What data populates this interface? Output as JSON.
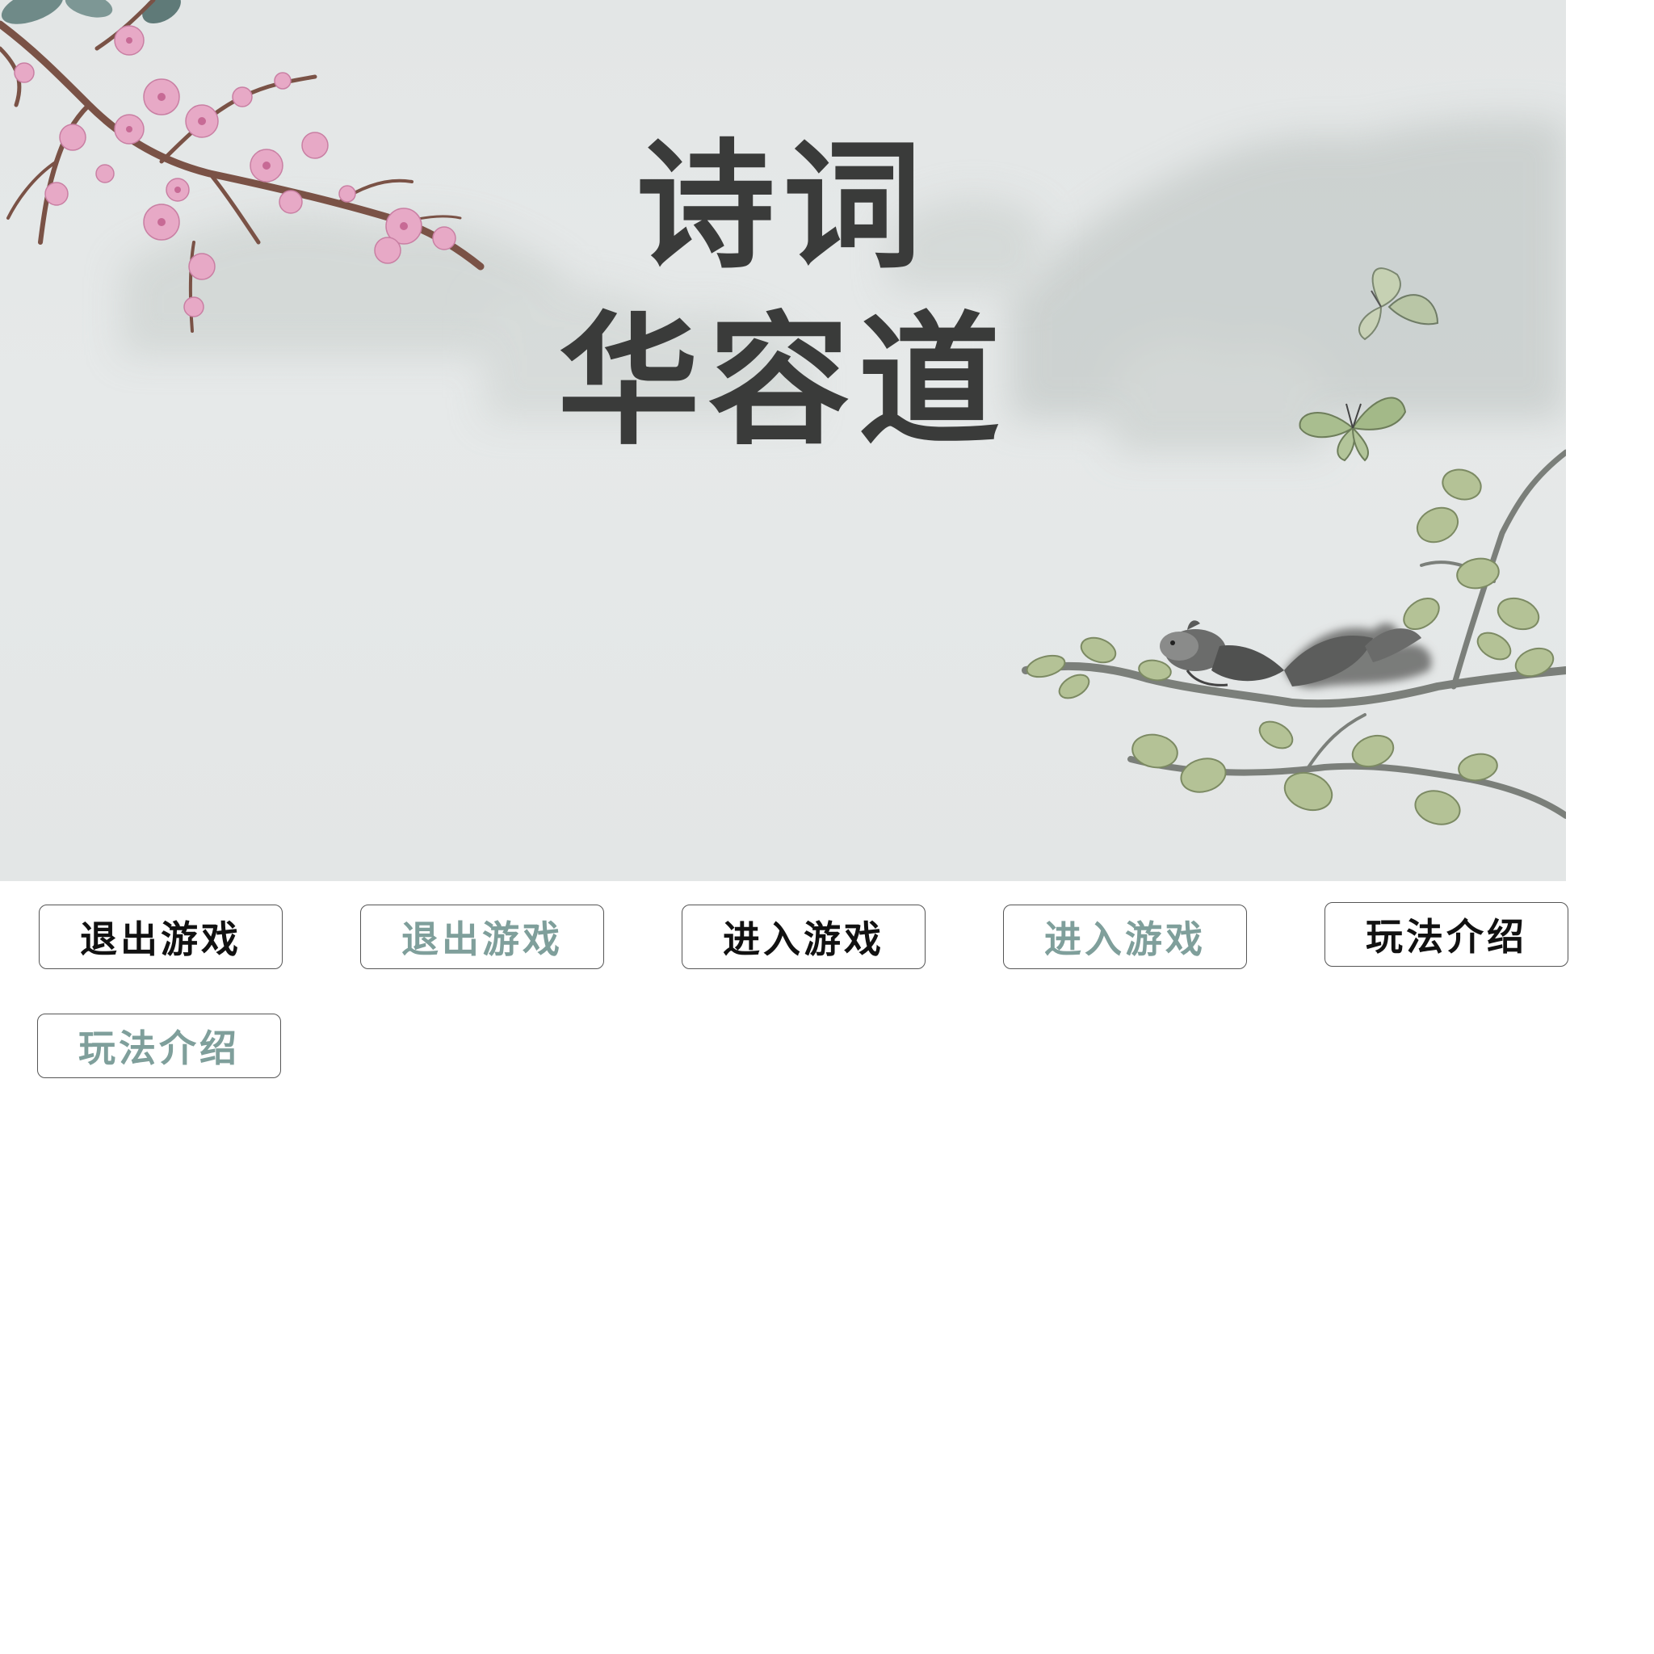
{
  "game": {
    "title_line1": "诗词",
    "title_line2": "华容道"
  },
  "buttons": {
    "exit_normal": "退出游戏",
    "exit_hover": "退出游戏",
    "enter_normal": "进入游戏",
    "enter_hover": "进入游戏",
    "rules_normal": "玩法介绍",
    "rules_hover": "玩法介绍"
  },
  "colors": {
    "background": "#e4e7e7",
    "title_ink": "#3a3b3a",
    "button_text": "#111111",
    "button_text_hover": "#7f9f9b",
    "blossom_pink": "#e7a9c6",
    "leaf_green": "#a9b98c"
  },
  "decorations": [
    "plum-blossom-branch",
    "ink-mountains",
    "butterflies",
    "squirrel-on-branch"
  ]
}
